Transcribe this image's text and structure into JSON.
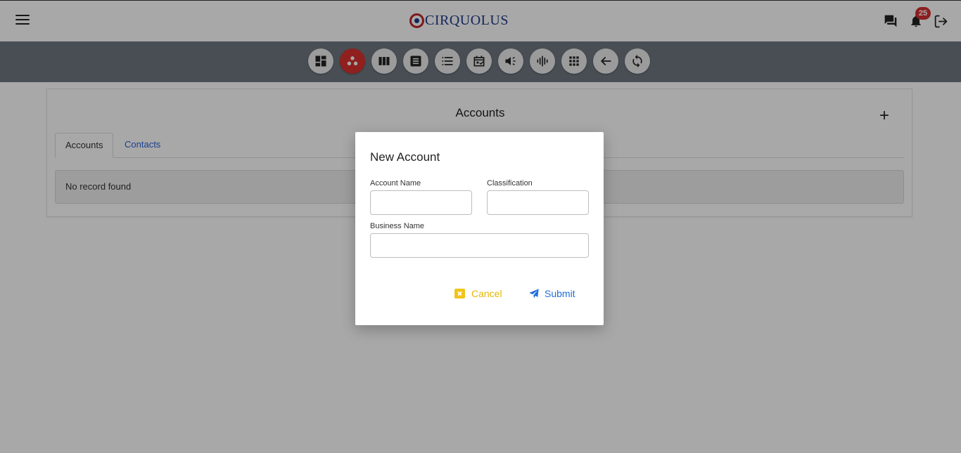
{
  "header": {
    "logo_text": "CIRQUOLUS",
    "notification_count": "25"
  },
  "toolbar": {
    "buttons": [
      {
        "icon": "dashboard-icon",
        "active": false
      },
      {
        "icon": "accounts-icon",
        "active": true
      },
      {
        "icon": "columns-icon",
        "active": false
      },
      {
        "icon": "document-icon",
        "active": false
      },
      {
        "icon": "list-icon",
        "active": false
      },
      {
        "icon": "calendar-icon",
        "active": false
      },
      {
        "icon": "campaign-icon",
        "active": false
      },
      {
        "icon": "voice-icon",
        "active": false
      },
      {
        "icon": "apps-grid-icon",
        "active": false
      },
      {
        "icon": "back-arrow-icon",
        "active": false
      },
      {
        "icon": "refresh-icon",
        "active": false
      }
    ],
    "active_color": "#d9312e",
    "bar_color": "#6f7782"
  },
  "main": {
    "title": "Accounts",
    "tabs": [
      {
        "label": "Accounts",
        "active": true
      },
      {
        "label": "Contacts",
        "active": false
      }
    ],
    "empty_message": "No record found"
  },
  "modal": {
    "title": "New Account",
    "fields": {
      "account_name": {
        "label": "Account Name",
        "value": ""
      },
      "classification": {
        "label": "Classification",
        "value": ""
      },
      "business_name": {
        "label": "Business Name",
        "value": ""
      }
    },
    "cancel_label": "Cancel",
    "submit_label": "Submit",
    "cancel_color": "#e6b800",
    "submit_color": "#1e6fd9"
  }
}
